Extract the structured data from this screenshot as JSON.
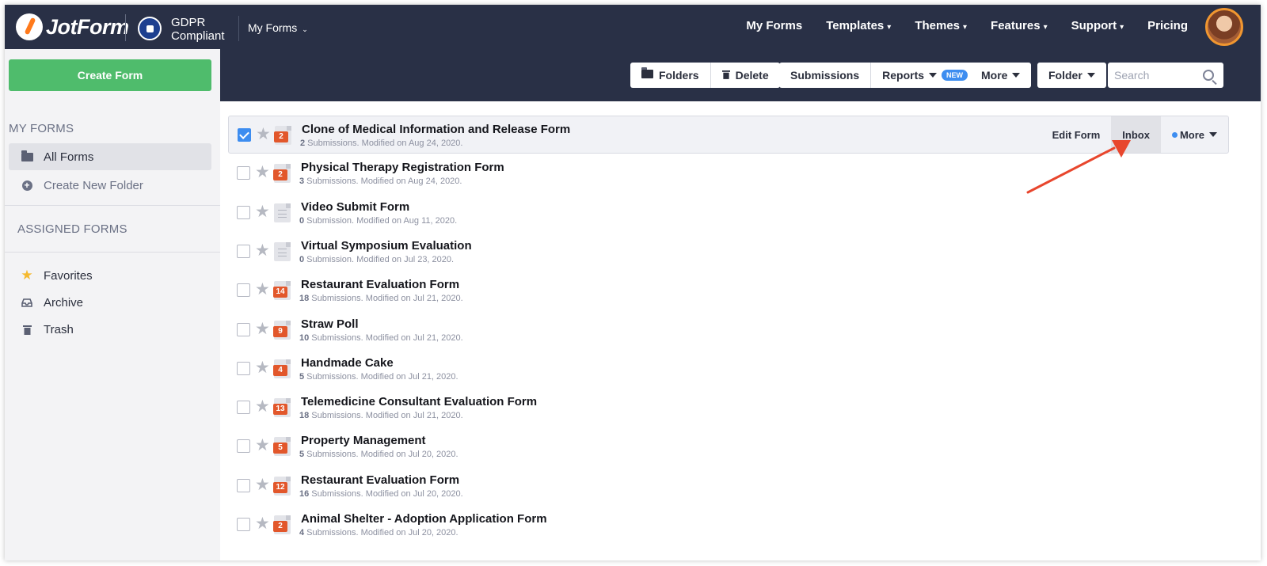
{
  "app": {
    "logo_text": "JotForm",
    "gdpr_line1": "GDPR",
    "gdpr_line2": "Compliant",
    "myforms_dropdown": "My Forms"
  },
  "nav": {
    "links": [
      "My Forms",
      "Templates",
      "Themes",
      "Features",
      "Support",
      "Pricing"
    ],
    "dropdown_chevron": "▾"
  },
  "sidebar": {
    "create_button": "Create Form",
    "my_forms_heading": "MY FORMS",
    "all_forms": "All Forms",
    "create_folder": "Create New Folder",
    "assigned_heading": "ASSIGNED FORMS",
    "favorites": "Favorites",
    "archive": "Archive",
    "trash": "Trash"
  },
  "toolbar": {
    "folders": "Folders",
    "delete": "Delete",
    "submissions": "Submissions",
    "reports": "Reports",
    "new_badge": "NEW",
    "more": "More",
    "folder": "Folder",
    "search_placeholder": "Search"
  },
  "row_actions": {
    "edit_form": "Edit Form",
    "inbox": "Inbox",
    "more": "More"
  },
  "forms": [
    {
      "title": "Clone of Medical Information and Release Form",
      "count": "2",
      "subs": "2",
      "meta": " Submissions. Modified on Aug 24, 2020.",
      "selected": true
    },
    {
      "title": "Physical Therapy Registration Form",
      "count": "2",
      "subs": "3",
      "meta": " Submissions. Modified on Aug 24, 2020."
    },
    {
      "title": "Video Submit Form",
      "count": "",
      "subs": "0",
      "meta": " Submission. Modified on Aug 11, 2020."
    },
    {
      "title": "Virtual Symposium Evaluation",
      "count": "",
      "subs": "0",
      "meta": " Submission. Modified on Jul 23, 2020."
    },
    {
      "title": "Restaurant Evaluation Form",
      "count": "14",
      "subs": "18",
      "meta": " Submissions. Modified on Jul 21, 2020."
    },
    {
      "title": "Straw Poll",
      "count": "9",
      "subs": "10",
      "meta": " Submissions. Modified on Jul 21, 2020."
    },
    {
      "title": "Handmade Cake",
      "count": "4",
      "subs": "5",
      "meta": " Submissions. Modified on Jul 21, 2020."
    },
    {
      "title": "Telemedicine Consultant Evaluation Form",
      "count": "13",
      "subs": "18",
      "meta": " Submissions. Modified on Jul 21, 2020."
    },
    {
      "title": "Property Management",
      "count": "5",
      "subs": "5",
      "meta": " Submissions. Modified on Jul 20, 2020."
    },
    {
      "title": "Restaurant Evaluation Form",
      "count": "12",
      "subs": "16",
      "meta": " Submissions. Modified on Jul 20, 2020."
    },
    {
      "title": "Animal Shelter - Adoption Application Form",
      "count": "2",
      "subs": "4",
      "meta": " Submissions. Modified on Jul 20, 2020."
    }
  ],
  "colors": {
    "nav_bg": "#293046",
    "create_green": "#4fbc6c",
    "badge_orange": "#e2572b",
    "accent_blue": "#3d8df0",
    "annotation_arrow": "#e8462d"
  }
}
